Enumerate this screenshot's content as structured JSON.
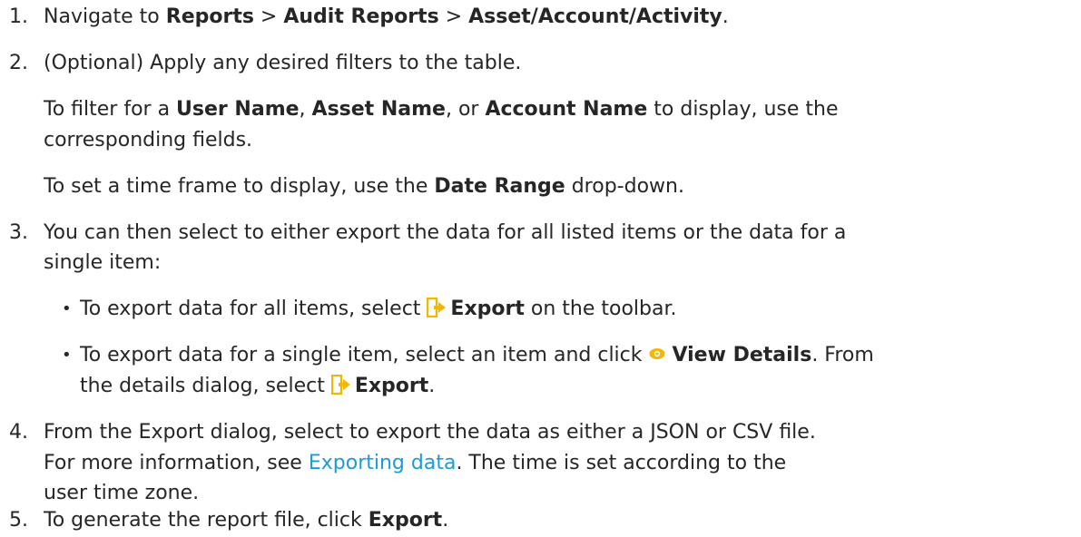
{
  "steps": [
    {
      "number": "1.",
      "prefix": "Navigate to ",
      "crumb1": "Reports",
      "sep1": " > ",
      "crumb2": "Audit Reports",
      "sep2": " > ",
      "crumb3": "Asset/Account/Activity",
      "suffix": "."
    },
    {
      "number": "2.",
      "text": "(Optional) Apply any desired filters to the table.",
      "sub1_prefix": "To filter for a ",
      "sub1_b1": "User Name",
      "sub1_sep1": ", ",
      "sub1_b2": "Asset Name",
      "sub1_sep2": ", or ",
      "sub1_b3": "Account Name",
      "sub1_suffix_line1": " to display, use the",
      "sub1_suffix_line2": "corresponding fields.",
      "sub2_prefix": "To set a time frame to display, use the ",
      "sub2_b": "Date Range",
      "sub2_suffix": " drop-down."
    },
    {
      "number": "3.",
      "line1": "You can then select to either export the data for all listed items or the data for a",
      "line2": "single item:",
      "bullet1_prefix": "To export data for all items, select ",
      "bullet1_b": "Export",
      "bullet1_suffix": " on the toolbar.",
      "bullet2_prefix": "To export data for a single item, select an item and click ",
      "bullet2_b": "View Details",
      "bullet2_suffix": ". From",
      "bullet2_line2_prefix": "the details dialog, select ",
      "bullet2_line2_b": "Export",
      "bullet2_line2_suffix": "."
    },
    {
      "number": "4.",
      "line1": "From the Export dialog, select to export the data as either a JSON or CSV file.",
      "line2_prefix": "For more information, see ",
      "line2_link": "Exporting data",
      "line2_suffix": ". The time is set according to the",
      "line3": "user time zone."
    },
    {
      "number": "5.",
      "prefix": "To generate the report file, click ",
      "b": "Export",
      "suffix": "."
    }
  ],
  "colors": {
    "text": "#262626",
    "link": "#1e9ad6",
    "icon": "#f2b705"
  },
  "icons": {
    "export": "export-icon",
    "view": "eye-icon"
  }
}
